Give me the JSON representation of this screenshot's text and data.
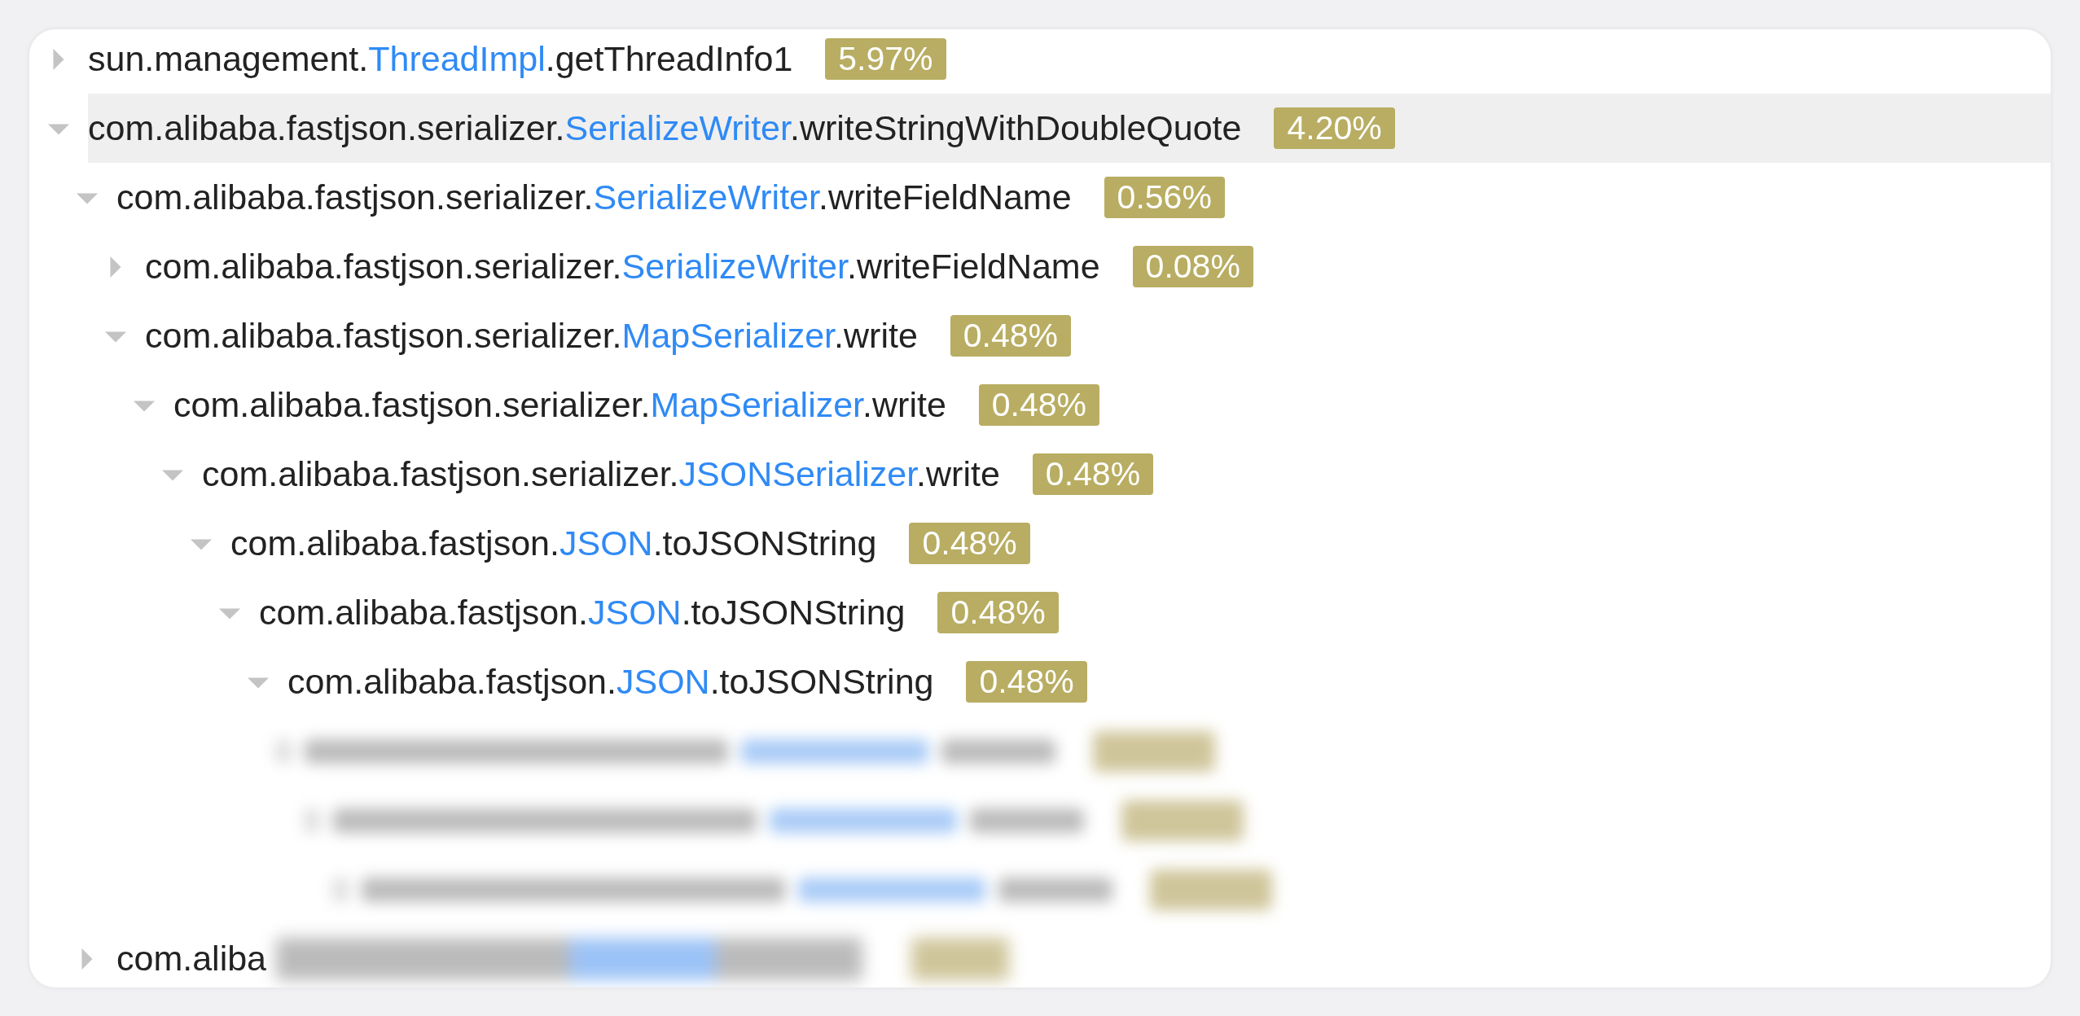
{
  "tree": [
    {
      "kind": "method",
      "package": "sun.management.",
      "class": "ThreadImpl",
      "method": ".getThreadInfo1",
      "percent": "5.97%",
      "expanded": false,
      "selected": false
    },
    {
      "kind": "method",
      "package": "com.alibaba.fastjson.serializer.",
      "class": "SerializeWriter",
      "method": ".writeStringWithDoubleQuote",
      "percent": "4.20%",
      "expanded": true,
      "selected": true,
      "children": [
        {
          "kind": "method",
          "package": "com.alibaba.fastjson.serializer.",
          "class": "SerializeWriter",
          "method": ".writeFieldName",
          "percent": "0.56%",
          "expanded": true,
          "selected": false,
          "children": [
            {
              "kind": "method",
              "package": "com.alibaba.fastjson.serializer.",
              "class": "SerializeWriter",
              "method": ".writeFieldName",
              "percent": "0.08%",
              "expanded": false,
              "selected": false
            },
            {
              "kind": "method",
              "package": "com.alibaba.fastjson.serializer.",
              "class": "MapSerializer",
              "method": ".write",
              "percent": "0.48%",
              "expanded": true,
              "selected": false,
              "children": [
                {
                  "kind": "method",
                  "package": "com.alibaba.fastjson.serializer.",
                  "class": "MapSerializer",
                  "method": ".write",
                  "percent": "0.48%",
                  "expanded": true,
                  "selected": false,
                  "children": [
                    {
                      "kind": "method",
                      "package": "com.alibaba.fastjson.serializer.",
                      "class": "JSONSerializer",
                      "method": ".write",
                      "percent": "0.48%",
                      "expanded": true,
                      "selected": false,
                      "children": [
                        {
                          "kind": "method",
                          "package": "com.alibaba.fastjson.",
                          "class": "JSON",
                          "method": ".toJSONString",
                          "percent": "0.48%",
                          "expanded": true,
                          "selected": false,
                          "children": [
                            {
                              "kind": "method",
                              "package": "com.alibaba.fastjson.",
                              "class": "JSON",
                              "method": ".toJSONString",
                              "percent": "0.48%",
                              "expanded": true,
                              "selected": false,
                              "children": [
                                {
                                  "kind": "method",
                                  "package": "com.alibaba.fastjson.",
                                  "class": "JSON",
                                  "method": ".toJSONString",
                                  "percent": "0.48%",
                                  "expanded": true,
                                  "selected": false,
                                  "children": [
                                    {
                                      "kind": "blurred",
                                      "children": [
                                        {
                                          "kind": "blurred",
                                          "children": [
                                            {
                                              "kind": "blurred"
                                            }
                                          ]
                                        }
                                      ]
                                    }
                                  ]
                                }
                              ]
                            }
                          ]
                        }
                      ]
                    }
                  ]
                }
              ]
            }
          ]
        },
        {
          "kind": "partial",
          "package": "com.aliba",
          "expanded": false,
          "selected": false
        }
      ]
    }
  ]
}
